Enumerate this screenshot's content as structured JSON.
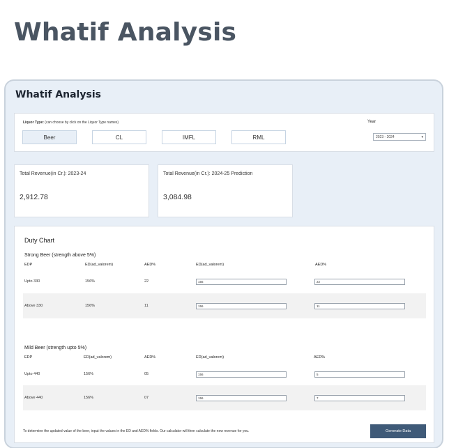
{
  "page_heading": "Whatif Analysis",
  "app": {
    "title": "Whatif Analysis",
    "filter": {
      "label_bold": "Liquor Type:",
      "label_hint": "(can choose by click on the Liquor Type names)",
      "liquor_types": [
        "Beer",
        "CL",
        "IMFL",
        "RML"
      ],
      "active_type": "Beer",
      "year_label": "Year",
      "year_value": "2023 - 2024"
    },
    "revenue": {
      "current_label": "Total Revenue(in Cr.): 2023-24",
      "current_value": "2,912.78",
      "prediction_label": "Total Revenue(in Cr.): 2024-25 Prediction",
      "prediction_value": "3,084.98"
    },
    "duty_chart": {
      "title": "Duty Chart",
      "strong": {
        "title": "Strong Beer (strength above 5%)",
        "headers": [
          "EDP",
          "ED(ad_valorem)",
          "AED%",
          "ED(ad_valorem)",
          "AED%"
        ],
        "rows": [
          {
            "edp": "Upto 330",
            "ed": "156%",
            "aed": "22",
            "ed_input": "156",
            "aed_input": "22"
          },
          {
            "edp": "Above 330",
            "ed": "156%",
            "aed": "11",
            "ed_input": "156",
            "aed_input": "11"
          }
        ]
      },
      "mild": {
        "title": "Mild Beer (strength upto 5%)",
        "headers": [
          "EDP",
          "ED(ad_valorem)",
          "AED%",
          "ED(ad_valorem)",
          "AED%"
        ],
        "rows": [
          {
            "edp": "Upto 440",
            "ed": "156%",
            "aed": "05",
            "ed_input": "156",
            "aed_input": "5"
          },
          {
            "edp": "Above 440",
            "ed": "156%",
            "aed": "07",
            "ed_input": "156",
            "aed_input": "7"
          }
        ]
      },
      "footer_note": "To determine the updated value of the beer, input the values in the ED and AED% fields. Our calculator will then calculate the new revenue for you.",
      "generate_label": "Generate Data"
    }
  },
  "colors": {
    "heading": "#4a5562",
    "window_bg": "#e8eff7",
    "active_button_bg": "#e8eff7",
    "generate_button": "#3f5a78",
    "shaded_row": "#f2f2f2"
  }
}
